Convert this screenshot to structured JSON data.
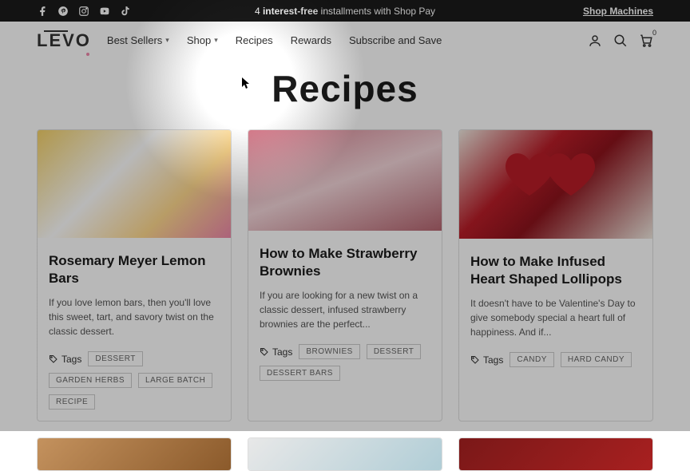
{
  "announcement": {
    "prefix": "4 ",
    "bold": "interest-free",
    "suffix": " installments with Shop Pay",
    "cta": "Shop Machines"
  },
  "brand": "LEVO",
  "nav": {
    "best_sellers": "Best Sellers",
    "shop": "Shop",
    "recipes": "Recipes",
    "rewards": "Rewards",
    "subscribe": "Subscribe and Save"
  },
  "cart_count": "0",
  "page_title": "Recipes",
  "tags_label": "Tags",
  "cards": [
    {
      "title": "Rosemary Meyer Lemon Bars",
      "excerpt": "If you love lemon bars, then you'll love this sweet, tart, and savory twist on the classic dessert.",
      "tags": [
        "DESSERT",
        "GARDEN HERBS",
        "LARGE BATCH",
        "RECIPE"
      ]
    },
    {
      "title": "How to Make Strawberry Brownies",
      "excerpt": "If you are looking for a new twist on a classic dessert, infused strawberry brownies are the perfect...",
      "tags": [
        "BROWNIES",
        "DESSERT",
        "DESSERT BARS"
      ]
    },
    {
      "title": "How to Make Infused Heart Shaped Lollipops",
      "excerpt": "It doesn't have to be Valentine's Day to give somebody special a heart full of happiness.  And if...",
      "tags": [
        "CANDY",
        "HARD CANDY"
      ]
    }
  ]
}
